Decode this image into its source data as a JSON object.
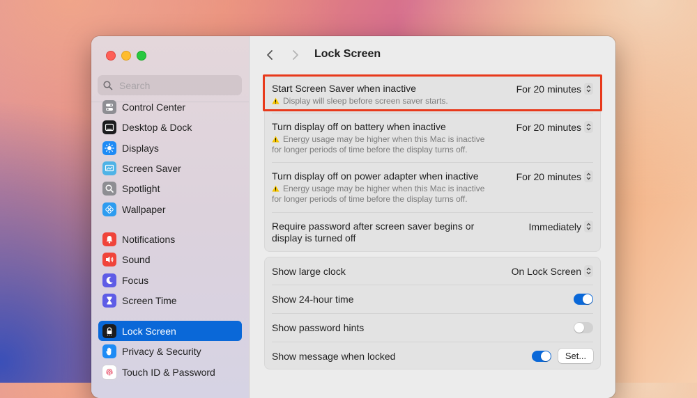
{
  "window": {
    "title": "Lock Screen"
  },
  "search": {
    "placeholder": "Search"
  },
  "sidebar": {
    "items": [
      {
        "label": "Control Center",
        "icon": "control-center-icon",
        "color": "#8e8e93"
      },
      {
        "label": "Desktop & Dock",
        "icon": "desktop-dock-icon",
        "color": "#1c1c1e"
      },
      {
        "label": "Displays",
        "icon": "displays-icon",
        "color": "#1e8bf5"
      },
      {
        "label": "Screen Saver",
        "icon": "screen-saver-icon",
        "color": "#4fb3e6"
      },
      {
        "label": "Spotlight",
        "icon": "spotlight-icon",
        "color": "#8e8e93"
      },
      {
        "label": "Wallpaper",
        "icon": "wallpaper-icon",
        "color": "#2d9cf0"
      },
      {
        "label": "Notifications",
        "icon": "notifications-icon",
        "color": "#f0443a"
      },
      {
        "label": "Sound",
        "icon": "sound-icon",
        "color": "#f0443a"
      },
      {
        "label": "Focus",
        "icon": "focus-icon",
        "color": "#5e5ce6"
      },
      {
        "label": "Screen Time",
        "icon": "screen-time-icon",
        "color": "#5e5ce6"
      },
      {
        "label": "Lock Screen",
        "icon": "lock-screen-icon",
        "color": "#1c1c1e",
        "active": true
      },
      {
        "label": "Privacy & Security",
        "icon": "privacy-hand-icon",
        "color": "#1e8bf5"
      },
      {
        "label": "Touch ID & Password",
        "icon": "fingerprint-icon",
        "color": "#ffffff"
      }
    ]
  },
  "group1": {
    "rows": [
      {
        "label": "Start Screen Saver when inactive",
        "sub": "Display will sleep before screen saver starts.",
        "value": "For 20 minutes"
      },
      {
        "label": "Turn display off on battery when inactive",
        "sub1": "Energy usage may be higher when this Mac is inactive",
        "sub2": "for longer periods of time before the display turns off.",
        "value": "For 20 minutes"
      },
      {
        "label": "Turn display off on power adapter when inactive",
        "sub1": "Energy usage may be higher when this Mac is inactive",
        "sub2": "for longer periods of time before the display turns off.",
        "value": "For 20 minutes"
      },
      {
        "label1": "Require password after screen saver begins or",
        "label2": "display is turned off",
        "value": "Immediately"
      }
    ]
  },
  "group2": {
    "rows": [
      {
        "label": "Show large clock",
        "value": "On Lock Screen"
      },
      {
        "label": "Show 24-hour time",
        "toggle": true
      },
      {
        "label": "Show password hints",
        "toggle": false
      },
      {
        "label": "Show message when locked",
        "toggle": true,
        "button": "Set..."
      }
    ]
  },
  "colors": {
    "accent": "#0a68d8",
    "highlight": "#e8391b",
    "warning": "#f5c400"
  }
}
